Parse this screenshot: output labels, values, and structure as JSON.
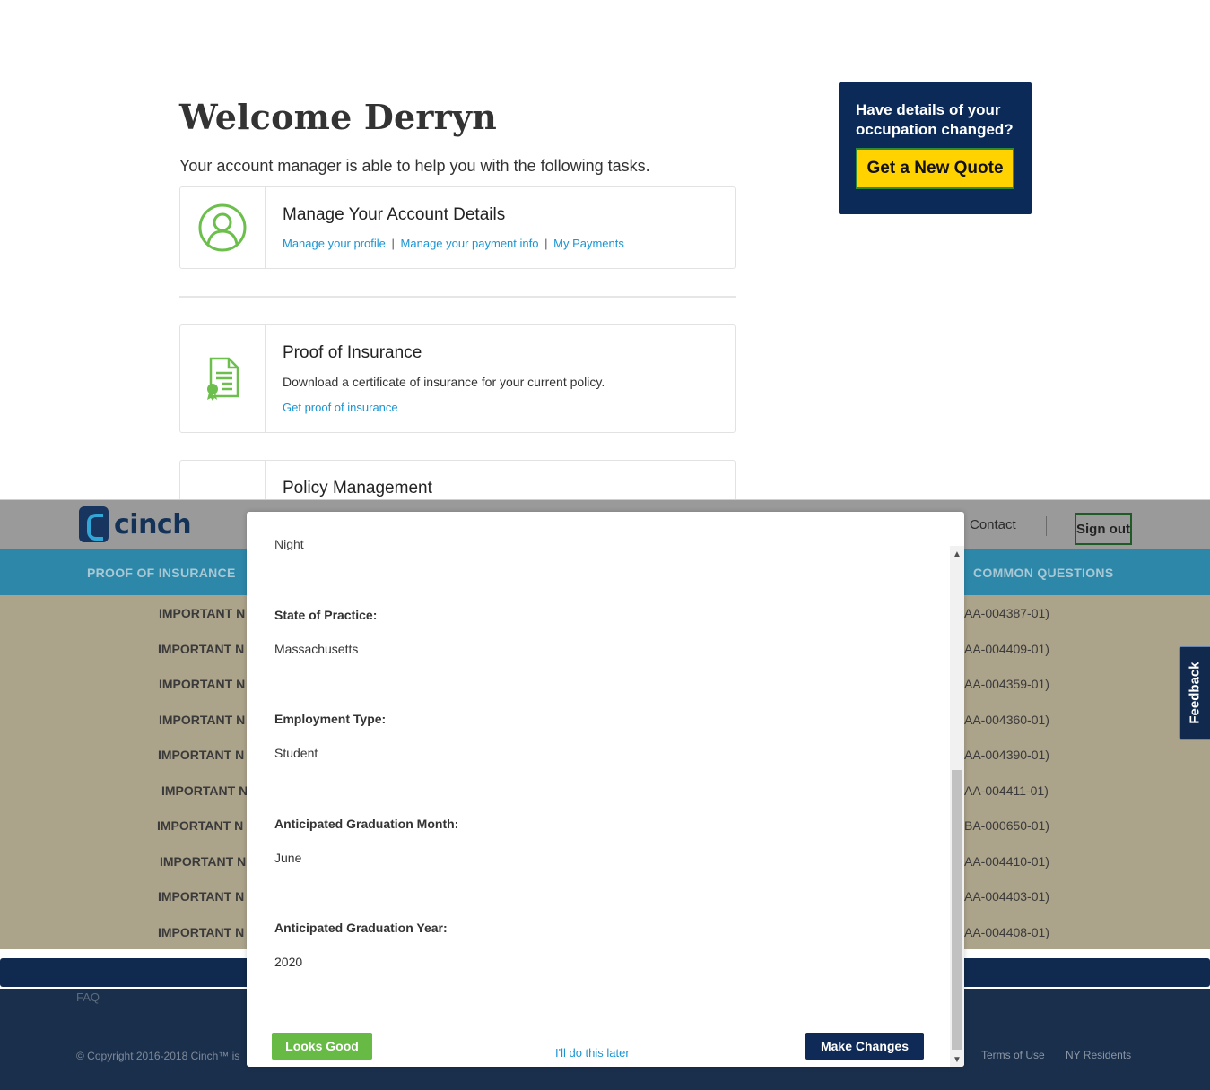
{
  "page": {
    "welcome": "Welcome Derryn",
    "intro": "Your account manager is able to help you with the following tasks."
  },
  "cards": {
    "account": {
      "title": "Manage Your Account Details",
      "links": [
        "Manage your profile",
        "Manage your payment info",
        "My Payments"
      ],
      "separator": "|"
    },
    "proof": {
      "title": "Proof of Insurance",
      "description": "Download a certificate of insurance for your current policy.",
      "link": "Get proof of insurance"
    },
    "policy": {
      "title": "Policy Management"
    }
  },
  "promo": {
    "question": "Have details of your occupation changed?",
    "button": "Get a New Quote"
  },
  "background": {
    "brand": "cinch",
    "contact": "Contact",
    "sign_out": "Sign out",
    "nav_left": "PROOF OF INSURANCE",
    "nav_right": "COMMON QUESTIONS",
    "rows": [
      {
        "left": "IMPORTANT N",
        "right": "AA-004387-01)"
      },
      {
        "left": "IMPORTANT N",
        "right": "AA-004409-01)"
      },
      {
        "left": "IMPORTANT N",
        "right": "AA-004359-01)"
      },
      {
        "left": "IMPORTANT N",
        "right": "AA-004360-01)"
      },
      {
        "left": "IMPORTANT N",
        "right": "AA-004390-01)"
      },
      {
        "left": "IMPORTANT N",
        "right": "AA-004411-01)"
      },
      {
        "left": "IMPORTANT N",
        "right": "BA-000650-01)"
      },
      {
        "left": "IMPORTANT N",
        "right": "AA-004410-01)"
      },
      {
        "left": "IMPORTANT N",
        "right": "AA-004403-01)"
      },
      {
        "left": "IMPORTANT N",
        "right": "AA-004408-01)"
      }
    ],
    "faq": "FAQ",
    "copyright": "© Copyright 2016-2018 Cinch™ is",
    "terms": "Terms of Use",
    "ny": "NY Residents",
    "feedback": "Feedback"
  },
  "modal": {
    "clipped_text": "Night",
    "fields": [
      {
        "label": "State of Practice:",
        "value": "Massachusetts"
      },
      {
        "label": "Employment Type:",
        "value": "Student"
      },
      {
        "label": "Anticipated Graduation Month:",
        "value": "June"
      },
      {
        "label": "Anticipated Graduation Year:",
        "value": "2020"
      }
    ],
    "looks_good": "Looks Good",
    "later": "I'll do this later",
    "make_changes": "Make Changes"
  },
  "colors": {
    "brand_navy": "#0f2a56",
    "link_blue": "#1b95d1",
    "success_green": "#67bb45",
    "quote_yellow": "#ffd200"
  }
}
